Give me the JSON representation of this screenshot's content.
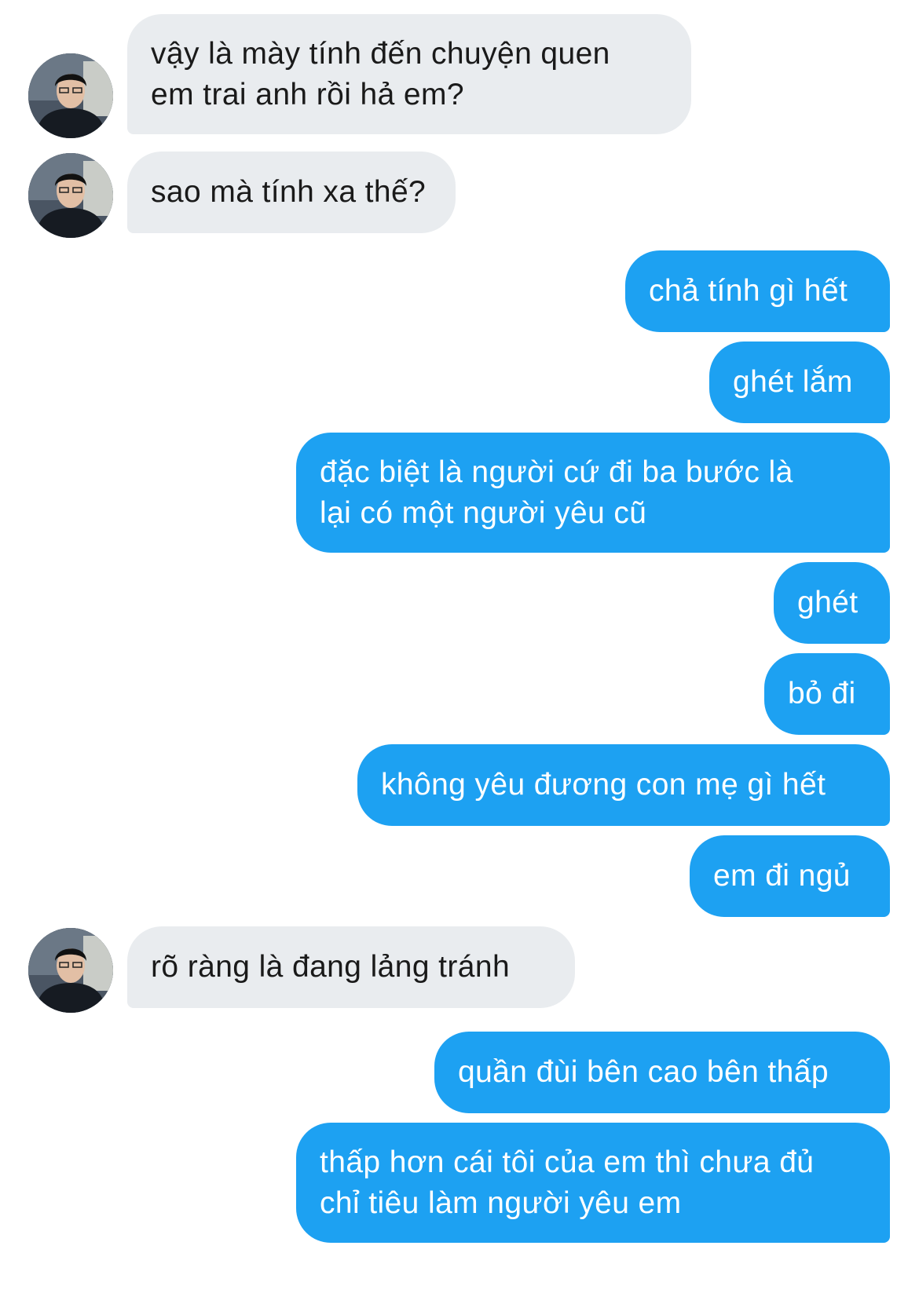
{
  "conversation": {
    "messages": [
      {
        "sender": "them",
        "text": "vậy là mày tính đến chuyện quen\nem trai anh rồi hả em?",
        "avatar_icon": "contact-avatar-icon"
      },
      {
        "sender": "them",
        "text": "sao mà tính xa thế?",
        "avatar_icon": "contact-avatar-icon"
      },
      {
        "sender": "me",
        "text": "chả tính gì hết"
      },
      {
        "sender": "me",
        "text": "ghét lắm"
      },
      {
        "sender": "me",
        "text": "đặc biệt là người cứ đi ba bước là\nlại có một người yêu cũ"
      },
      {
        "sender": "me",
        "text": "ghét"
      },
      {
        "sender": "me",
        "text": "bỏ đi"
      },
      {
        "sender": "me",
        "text": "không yêu đương con mẹ gì hết"
      },
      {
        "sender": "me",
        "text": "em đi ngủ"
      },
      {
        "sender": "them",
        "text": "rõ ràng là đang lảng tránh",
        "avatar_icon": "contact-avatar-icon"
      },
      {
        "sender": "me",
        "text": "quần đùi bên cao bên thấp"
      },
      {
        "sender": "me",
        "text": "thấp hơn cái tôi của em thì chưa đủ\nchỉ tiêu làm người yêu em"
      }
    ]
  },
  "colors": {
    "incoming_bubble": "#e9ecef",
    "outgoing_bubble": "#1da1f2",
    "incoming_text": "#1a1a1a",
    "outgoing_text": "#ffffff",
    "background": "#ffffff"
  }
}
